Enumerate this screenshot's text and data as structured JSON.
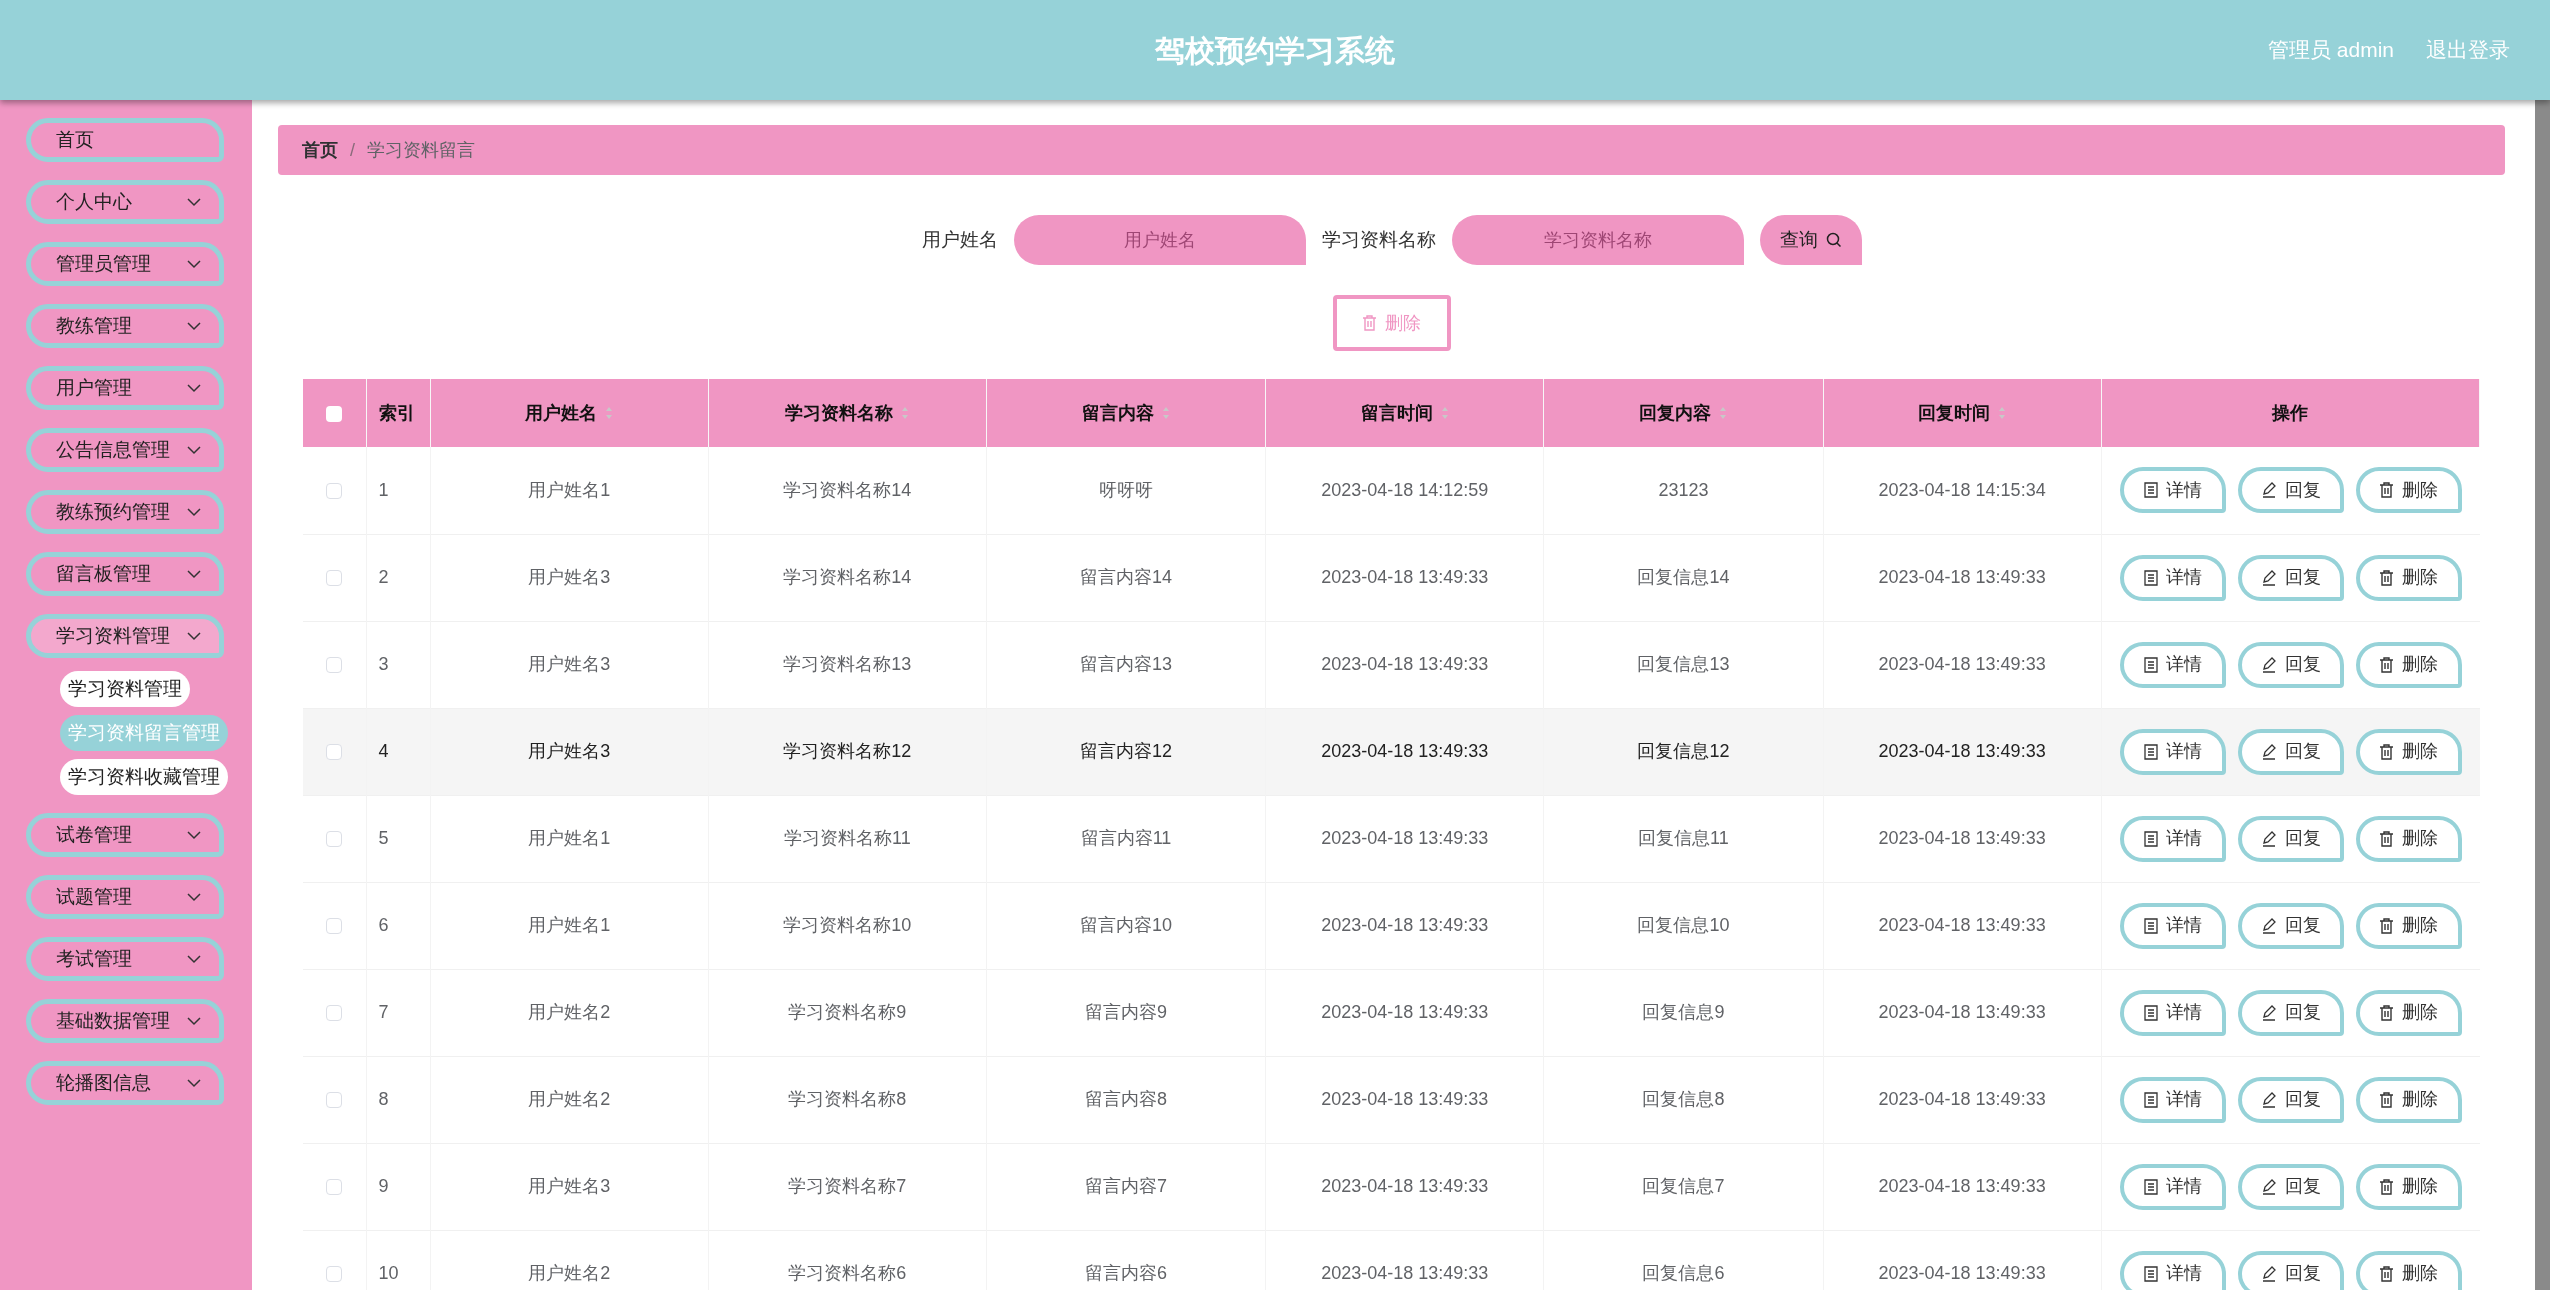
{
  "header": {
    "title": "驾校预约学习系统",
    "user": "管理员 admin",
    "logout": "退出登录"
  },
  "sidebar": {
    "items": [
      {
        "label": "首页",
        "has_arrow": false,
        "expanded": false
      },
      {
        "label": "个人中心",
        "has_arrow": true,
        "expanded": false
      },
      {
        "label": "管理员管理",
        "has_arrow": true,
        "expanded": false
      },
      {
        "label": "教练管理",
        "has_arrow": true,
        "expanded": false
      },
      {
        "label": "用户管理",
        "has_arrow": true,
        "expanded": false
      },
      {
        "label": "公告信息管理",
        "has_arrow": true,
        "expanded": false
      },
      {
        "label": "教练预约管理",
        "has_arrow": true,
        "expanded": false
      },
      {
        "label": "留言板管理",
        "has_arrow": true,
        "expanded": false
      },
      {
        "label": "学习资料管理",
        "has_arrow": true,
        "expanded": true,
        "children": [
          {
            "label": "学习资料管理",
            "selected": false
          },
          {
            "label": "学习资料留言管理",
            "selected": true
          },
          {
            "label": "学习资料收藏管理",
            "selected": false
          }
        ]
      },
      {
        "label": "试卷管理",
        "has_arrow": true,
        "expanded": false
      },
      {
        "label": "试题管理",
        "has_arrow": true,
        "expanded": false
      },
      {
        "label": "考试管理",
        "has_arrow": true,
        "expanded": false
      },
      {
        "label": "基础数据管理",
        "has_arrow": true,
        "expanded": false
      },
      {
        "label": "轮播图信息",
        "has_arrow": true,
        "expanded": false
      }
    ]
  },
  "breadcrumb": {
    "items": [
      "首页",
      "学习资料留言"
    ],
    "separator": "/"
  },
  "search": {
    "fields": [
      {
        "label": "用户姓名",
        "placeholder": "用户姓名"
      },
      {
        "label": "学习资料名称",
        "placeholder": "学习资料名称"
      }
    ],
    "button": "查询"
  },
  "bulk_delete": "删除",
  "table": {
    "select_all_checked": false,
    "columns": [
      {
        "label": "索引",
        "sortable": false
      },
      {
        "label": "用户姓名",
        "sortable": true
      },
      {
        "label": "学习资料名称",
        "sortable": true
      },
      {
        "label": "留言内容",
        "sortable": true
      },
      {
        "label": "留言时间",
        "sortable": true
      },
      {
        "label": "回复内容",
        "sortable": true
      },
      {
        "label": "回复时间",
        "sortable": true
      },
      {
        "label": "操作",
        "sortable": false
      }
    ],
    "rows": [
      {
        "cells": [
          "1",
          "用户姓名1",
          "学习资料名称14",
          "呀呀呀",
          "2023-04-18 14:12:59",
          "23123",
          "2023-04-18 14:15:34"
        ],
        "actions": [
          "详情",
          "回复",
          "删除"
        ],
        "highlighted": false,
        "checked": false
      },
      {
        "cells": [
          "2",
          "用户姓名3",
          "学习资料名称14",
          "留言内容14",
          "2023-04-18 13:49:33",
          "回复信息14",
          "2023-04-18 13:49:33"
        ],
        "actions": [
          "详情",
          "回复",
          "删除"
        ],
        "highlighted": false,
        "checked": false
      },
      {
        "cells": [
          "3",
          "用户姓名3",
          "学习资料名称13",
          "留言内容13",
          "2023-04-18 13:49:33",
          "回复信息13",
          "2023-04-18 13:49:33"
        ],
        "actions": [
          "详情",
          "回复",
          "删除"
        ],
        "highlighted": false,
        "checked": false
      },
      {
        "cells": [
          "4",
          "用户姓名3",
          "学习资料名称12",
          "留言内容12",
          "2023-04-18 13:49:33",
          "回复信息12",
          "2023-04-18 13:49:33"
        ],
        "actions": [
          "详情",
          "回复",
          "删除"
        ],
        "highlighted": true,
        "checked": false
      },
      {
        "cells": [
          "5",
          "用户姓名1",
          "学习资料名称11",
          "留言内容11",
          "2023-04-18 13:49:33",
          "回复信息11",
          "2023-04-18 13:49:33"
        ],
        "actions": [
          "详情",
          "回复",
          "删除"
        ],
        "highlighted": false,
        "checked": false
      },
      {
        "cells": [
          "6",
          "用户姓名1",
          "学习资料名称10",
          "留言内容10",
          "2023-04-18 13:49:33",
          "回复信息10",
          "2023-04-18 13:49:33"
        ],
        "actions": [
          "详情",
          "回复",
          "删除"
        ],
        "highlighted": false,
        "checked": false
      },
      {
        "cells": [
          "7",
          "用户姓名2",
          "学习资料名称9",
          "留言内容9",
          "2023-04-18 13:49:33",
          "回复信息9",
          "2023-04-18 13:49:33"
        ],
        "actions": [
          "详情",
          "回复",
          "删除"
        ],
        "highlighted": false,
        "checked": false
      },
      {
        "cells": [
          "8",
          "用户姓名2",
          "学习资料名称8",
          "留言内容8",
          "2023-04-18 13:49:33",
          "回复信息8",
          "2023-04-18 13:49:33"
        ],
        "actions": [
          "详情",
          "回复",
          "删除"
        ],
        "highlighted": false,
        "checked": false
      },
      {
        "cells": [
          "9",
          "用户姓名3",
          "学习资料名称7",
          "留言内容7",
          "2023-04-18 13:49:33",
          "回复信息7",
          "2023-04-18 13:49:33"
        ],
        "actions": [
          "详情",
          "回复",
          "删除"
        ],
        "highlighted": false,
        "checked": false
      },
      {
        "cells": [
          "10",
          "用户姓名2",
          "学习资料名称6",
          "留言内容6",
          "2023-04-18 13:49:33",
          "回复信息6",
          "2023-04-18 13:49:33"
        ],
        "actions": [
          "详情",
          "回复",
          "删除"
        ],
        "highlighted": false,
        "checked": false
      }
    ]
  }
}
